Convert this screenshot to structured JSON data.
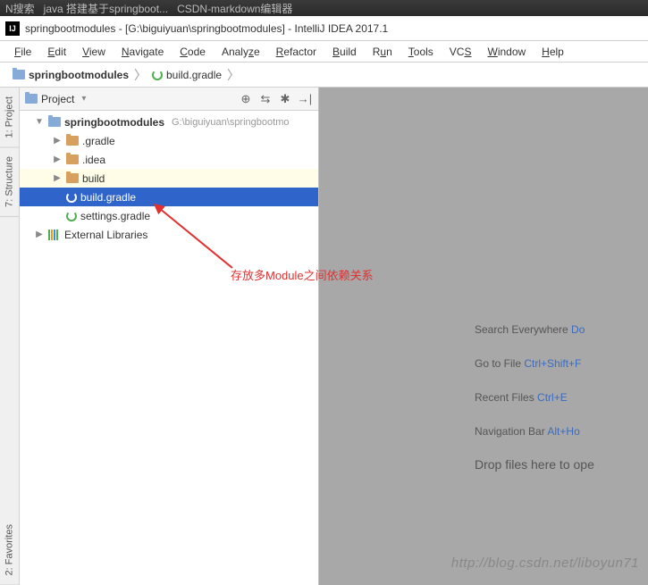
{
  "taskbar": {
    "items": [
      "N搜索",
      "java 搭建基于springboot...",
      "CSDN-markdown编辑器"
    ]
  },
  "window": {
    "title": "springbootmodules - [G:\\biguiyuan\\springbootmodules] - IntelliJ IDEA 2017.1"
  },
  "menu": {
    "items": [
      "File",
      "Edit",
      "View",
      "Navigate",
      "Code",
      "Analyze",
      "Refactor",
      "Build",
      "Run",
      "Tools",
      "VCS",
      "Window",
      "Help"
    ],
    "underlines": [
      "F",
      "E",
      "V",
      "N",
      "C",
      "A",
      "R",
      "B",
      "u",
      "T",
      "S",
      "W",
      "H"
    ]
  },
  "breadcrumb": {
    "project": "springbootmodules",
    "file": "build.gradle"
  },
  "project_panel": {
    "title": "Project",
    "buttons": [
      "target",
      "arrows",
      "gear",
      "separator",
      "hide"
    ]
  },
  "tree": {
    "root": {
      "label": "springbootmodules",
      "path": "G:\\biguiyuan\\springbootmo"
    },
    "gradle_dir": ".gradle",
    "idea_dir": ".idea",
    "build_dir": "build",
    "build_gradle": "build.gradle",
    "settings_gradle": "settings.gradle",
    "external_libs": "External Libraries"
  },
  "gutter": {
    "project": "1: Project",
    "structure": "7: Structure",
    "favorites": "2: Favorites"
  },
  "hints": {
    "search": "Search Everywhere ",
    "search_key": "Do",
    "goto": "Go to File ",
    "goto_key": "Ctrl+Shift+F",
    "recent": "Recent Files ",
    "recent_key": "Ctrl+E",
    "nav": "Navigation Bar ",
    "nav_key": "Alt+Ho",
    "drop": "Drop files here to ope"
  },
  "annotation": {
    "text": "存放多Module之间依赖关系",
    "watermark": "http://blog.csdn.net/liboyun71"
  }
}
